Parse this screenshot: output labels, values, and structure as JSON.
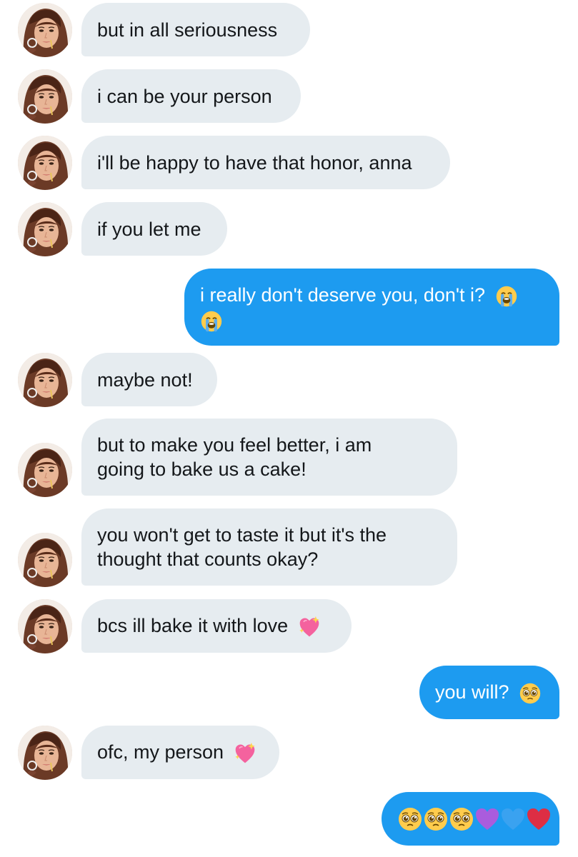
{
  "contact": {
    "avatar_icon": "profile-photo-icon"
  },
  "messages": [
    {
      "direction": "in",
      "lines": [
        "but in all seriousness"
      ],
      "emojis": []
    },
    {
      "direction": "in",
      "lines": [
        "i can be your person"
      ],
      "emojis": []
    },
    {
      "direction": "in",
      "lines": [
        "i'll be happy to have that honor, anna"
      ],
      "emojis": []
    },
    {
      "direction": "in",
      "lines": [
        "if you let me"
      ],
      "emojis": []
    },
    {
      "direction": "out",
      "lines": [
        "i really don't deserve you, don't i? "
      ],
      "emojis": [
        "loudly-crying-face-icon",
        "loudly-crying-face-icon"
      ]
    },
    {
      "direction": "in",
      "lines": [
        "maybe not!"
      ],
      "emojis": []
    },
    {
      "direction": "in",
      "lines": [
        "but to make you feel better, i am",
        "going to bake us a cake!"
      ],
      "emojis": []
    },
    {
      "direction": "in",
      "lines": [
        "you won't get to taste it but it's the",
        "thought that counts okay?"
      ],
      "emojis": []
    },
    {
      "direction": "in",
      "lines": [
        "bcs ill bake it with love "
      ],
      "emojis": [
        "sparkling-heart-icon"
      ]
    },
    {
      "direction": "out",
      "lines": [
        "you will? "
      ],
      "emojis": [
        "pleading-face-icon"
      ]
    },
    {
      "direction": "in",
      "lines": [
        "ofc, my person "
      ],
      "emojis": [
        "sparkling-heart-icon"
      ]
    },
    {
      "direction": "out",
      "lines": [
        ""
      ],
      "emojis": [
        "pleading-face-icon",
        "pleading-face-icon",
        "pleading-face-icon",
        "purple-heart-icon",
        "blue-heart-icon",
        "red-heart-icon"
      ]
    }
  ],
  "colors": {
    "incoming_bubble": "#e6ecf0",
    "outgoing_bubble": "#1d9bf0",
    "incoming_text": "#14171a",
    "outgoing_text": "#ffffff"
  }
}
